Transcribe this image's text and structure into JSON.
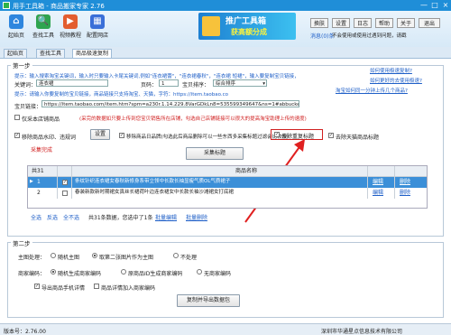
{
  "window": {
    "title": "用手工具箱 - 商品搬家专家 2.76",
    "minimize": "—",
    "maximize": "□",
    "close": "×"
  },
  "toolbar": {
    "items": [
      {
        "label": "起始页",
        "icon": "home-icon",
        "color": "#2e86de"
      },
      {
        "label": "查找工具",
        "icon": "search-icon",
        "color": "#2ea44f"
      },
      {
        "label": "视频教程",
        "icon": "video-icon",
        "color": "#e35d2f"
      },
      {
        "label": "配置网店",
        "icon": "store-icon",
        "color": "#3a6fd8"
      }
    ],
    "banner_line1": "推广工具箱",
    "banner_line2": "获高额分成",
    "buttons": {
      "switch": "换肤",
      "settings": "设置",
      "log": "日志",
      "help": "帮助",
      "about": "关于",
      "exit": "退出"
    },
    "message": "消息(0)条",
    "message_note": "不会使用或使用过遇到问题，请戳"
  },
  "tabs": [
    {
      "label": "起始页"
    },
    {
      "label": "查找工具"
    },
    {
      "label": "商品极速复制"
    }
  ],
  "step1": {
    "title": "第一步",
    "hint1": "提示：输入搜索淘宝关键词，输入时只要输入卡尾关键词,例如\"连衣裙蕾\"，\"连衣裙春秋\"，\"连衣裙 短裙\"，输入要复制宝贝链接，",
    "hint1_link": "如何使用极速复制?",
    "keyword_label": "关键词：",
    "keyword_value": "连衣裙",
    "page_label": "页码：",
    "page_value": "1",
    "sort_label": "宝贝排序：",
    "sort_value": "综合排序",
    "link_howto": "如何更好的去使用极速?",
    "hint2": "提示：请输入你要复制的宝贝链接，商品链接只支持淘宝、天猫，字符：https://item.taobao.co",
    "link_taobao": "淘宝如何同一分钟上传几个商品?",
    "url_label": "宝贝链接：",
    "url_value": "https://item.taobao.com/item.htm?spm=a230r.1.14.229.8VarGDkLn8=535599349647&ns=1#abbucket=19#detail",
    "check_store": "仅采本店铺商品",
    "store_hint": "(采完的数据如只要上传到您宝贝销售所在店铺，勾选自己店铺链接可以很大的提高淘宝助理上传的速度)",
    "check_watermark": "移除商品水印、违规词",
    "btn_settings": "设置",
    "check_remove_title": "移除商品日品牌(勾选此后商品删除可以一些东西多采集标题过滤会比较慢)",
    "check_dedupe_title": "去除重复标题",
    "check_tmall": "去除天猫商品标题",
    "collect_status": "采集完成",
    "btn_collect": "采集标题"
  },
  "grid": {
    "count_label": "共31",
    "headers": [
      "",
      "",
      "商品名称",
      "",
      ""
    ],
    "rows": [
      {
        "num": "1",
        "checked": true,
        "name": "条纹针织连衣裙女春秋新修身系带立领中长款长袖显瘦气质OL气质裙子",
        "edit": "编辑",
        "delete": "删除"
      },
      {
        "num": "2",
        "checked": false,
        "name": "春装新款新时期裙女真丝长裙荷叶边连衣裙女中长款长袖沙滩裙女打底裙",
        "edit": "编辑",
        "delete": "删除"
      }
    ],
    "footer": {
      "select_all": "全选",
      "invert": "反选",
      "all": "全不选",
      "count_text": "共31条数据，您选中了1条",
      "batch_edit": "批量编辑",
      "batch_delete": "批量删除"
    }
  },
  "step2": {
    "title": "第二步",
    "main_img_label": "主图处理：",
    "main_img_options": [
      "随机主图",
      "取第二张图片作为主图",
      "不处理"
    ],
    "main_img_selected": 1,
    "code_label": "商家编码：",
    "code_options": [
      "随机生成商家编码",
      "原商品ID生成商家编码",
      "无商家编码"
    ],
    "code_selected": 0,
    "check_export_detail": "导出商品手机详情",
    "check_export_sku": "商品详情加入商家编码",
    "btn_export": "复制并导出数据包"
  },
  "status": {
    "version": "版本号：2.76.00",
    "company": "深圳市华通星点信息技术有限公司"
  }
}
